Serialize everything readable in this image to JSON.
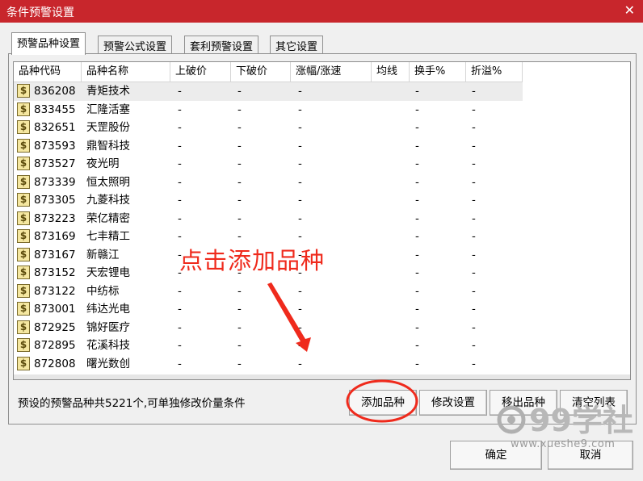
{
  "window": {
    "title": "条件预警设置",
    "close_glyph": "✕"
  },
  "tabs": [
    {
      "label": "预警品种设置",
      "active": true
    },
    {
      "label": "预警公式设置",
      "active": false
    },
    {
      "label": "套利预警设置",
      "active": false
    },
    {
      "label": "其它设置",
      "active": false
    }
  ],
  "table": {
    "headers": [
      "品种代码",
      "品种名称",
      "上破价",
      "下破价",
      "涨幅/涨速",
      "均线",
      "换手%",
      "折溢%"
    ],
    "rows": [
      {
        "code": "836208",
        "name": "青矩技术",
        "up": "-",
        "down": "-",
        "chg": "-",
        "turn": "-",
        "prem": "-"
      },
      {
        "code": "833455",
        "name": "汇隆活塞",
        "up": "-",
        "down": "-",
        "chg": "-",
        "turn": "-",
        "prem": "-"
      },
      {
        "code": "832651",
        "name": "天罡股份",
        "up": "-",
        "down": "-",
        "chg": "-",
        "turn": "-",
        "prem": "-"
      },
      {
        "code": "873593",
        "name": "鼎智科技",
        "up": "-",
        "down": "-",
        "chg": "-",
        "turn": "-",
        "prem": "-"
      },
      {
        "code": "873527",
        "name": "夜光明",
        "up": "-",
        "down": "-",
        "chg": "-",
        "turn": "-",
        "prem": "-"
      },
      {
        "code": "873339",
        "name": "恒太照明",
        "up": "-",
        "down": "-",
        "chg": "-",
        "turn": "-",
        "prem": "-"
      },
      {
        "code": "873305",
        "name": "九菱科技",
        "up": "-",
        "down": "-",
        "chg": "-",
        "turn": "-",
        "prem": "-"
      },
      {
        "code": "873223",
        "name": "荣亿精密",
        "up": "-",
        "down": "-",
        "chg": "-",
        "turn": "-",
        "prem": "-"
      },
      {
        "code": "873169",
        "name": "七丰精工",
        "up": "-",
        "down": "-",
        "chg": "-",
        "turn": "-",
        "prem": "-"
      },
      {
        "code": "873167",
        "name": "新赣江",
        "up": "-",
        "down": "-",
        "chg": "-",
        "turn": "-",
        "prem": "-"
      },
      {
        "code": "873152",
        "name": "天宏锂电",
        "up": "-",
        "down": "-",
        "chg": "-",
        "turn": "-",
        "prem": "-"
      },
      {
        "code": "873122",
        "name": "中纺标",
        "up": "-",
        "down": "-",
        "chg": "-",
        "turn": "-",
        "prem": "-"
      },
      {
        "code": "873001",
        "name": "纬达光电",
        "up": "-",
        "down": "-",
        "chg": "-",
        "turn": "-",
        "prem": "-"
      },
      {
        "code": "872925",
        "name": "锦好医疗",
        "up": "-",
        "down": "-",
        "chg": "-",
        "turn": "-",
        "prem": "-"
      },
      {
        "code": "872895",
        "name": "花溪科技",
        "up": "-",
        "down": "-",
        "chg": "-",
        "turn": "-",
        "prem": "-"
      },
      {
        "code": "872808",
        "name": "曙光数创",
        "up": "-",
        "down": "-",
        "chg": "-",
        "turn": "-",
        "prem": "-"
      }
    ],
    "row_icon_glyph": "$"
  },
  "status_text": "预设的预警品种共5221个,可单独修改价量条件",
  "buttons": {
    "add": "添加品种",
    "modify": "修改设置",
    "remove": "移出品种",
    "clear": "清空列表",
    "ok": "确定",
    "cancel": "取消"
  },
  "annotation": {
    "text": "点击添加品种",
    "color": "#ef2a1c"
  },
  "watermark": {
    "logo_text": "99学社",
    "url": "www.xueshe9.com"
  },
  "colors": {
    "titlebar": "#c8262c",
    "annotation": "#ef2a1c"
  }
}
